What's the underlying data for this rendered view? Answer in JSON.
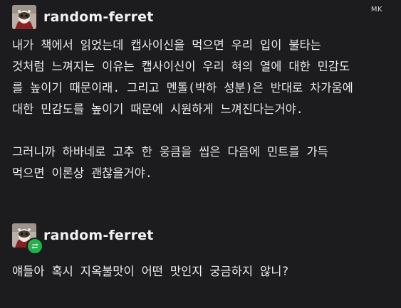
{
  "indicator": {
    "text": "MK"
  },
  "posts": [
    {
      "username": "random-ferret",
      "avatar_icon": "ferret-avatar",
      "reblogged": false,
      "paragraphs": [
        [
          "내가 책에서 읽었는데 캡사이신을 먹으면 우리 입이 불타는",
          "것처럼 느껴지는 이유는 캡사이신이 우리 혀의 열에 대한 민감도",
          "를 높이기 때문이래. 그리고 멘톨(박하 성분)은 반대로 차가움에",
          "대한 민감도를 높이기 때문에 시원하게 느껴진다는거야."
        ],
        [
          "그러니까 하바네로 고추 한 웅큼을 씹은 다음에 민트를 가득",
          "먹으면 이론상 괜찮을거야."
        ]
      ]
    },
    {
      "username": "random-ferret",
      "avatar_icon": "ferret-avatar",
      "reblogged": true,
      "reblog_icon": "reblog-icon",
      "paragraphs": [
        [
          "얘들아 혹시 지옥불맛이 어떤 맛인지 궁금하지 않니?"
        ]
      ]
    }
  ],
  "colors": {
    "background": "#1c1c1e",
    "text": "#ececec",
    "reblog_badge": "#21b14a"
  }
}
